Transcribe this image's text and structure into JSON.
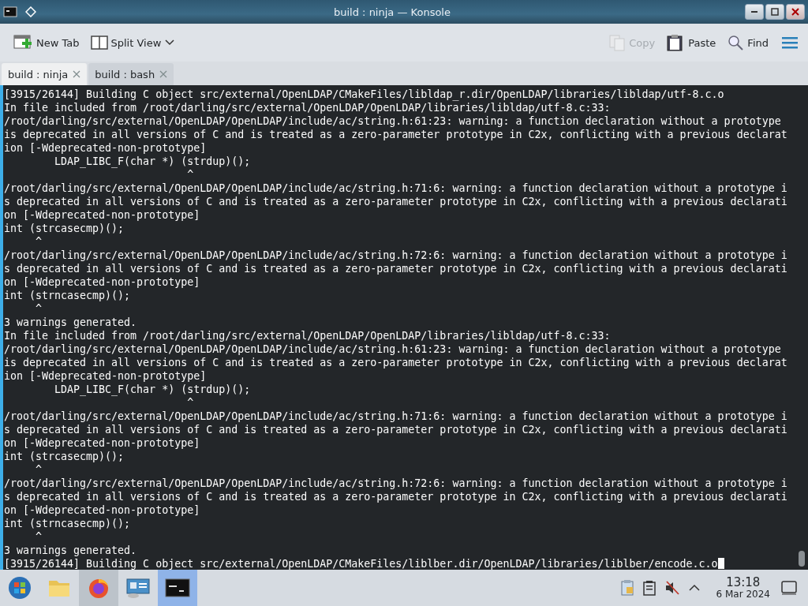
{
  "window": {
    "title": "build : ninja — Konsole"
  },
  "toolbar": {
    "left": [
      {
        "kind": "new-tab",
        "label": "New Tab",
        "disabled": false
      },
      {
        "kind": "split-view",
        "label": "Split View",
        "disabled": false
      }
    ],
    "right": [
      {
        "kind": "copy",
        "label": "Copy",
        "disabled": true
      },
      {
        "kind": "paste",
        "label": "Paste",
        "disabled": false
      },
      {
        "kind": "find",
        "label": "Find",
        "disabled": false
      }
    ]
  },
  "tabs": [
    {
      "label": "build : ninja",
      "selected": true
    },
    {
      "label": "build : bash",
      "selected": false
    }
  ],
  "terminal": {
    "cursor_visible": true,
    "lines": [
      "[3915/26144] Building C object src/external/OpenLDAP/CMakeFiles/libldap_r.dir/OpenLDAP/libraries/libldap/utf-8.c.o",
      "In file included from /root/darling/src/external/OpenLDAP/OpenLDAP/libraries/libldap/utf-8.c:33:",
      "/root/darling/src/external/OpenLDAP/OpenLDAP/include/ac/string.h:61:23: warning: a function declaration without a prototype",
      "is deprecated in all versions of C and is treated as a zero-parameter prototype in C2x, conflicting with a previous declarat",
      "ion [-Wdeprecated-non-prototype]",
      "        LDAP_LIBC_F(char *) (strdup)();",
      "                             ^",
      "/root/darling/src/external/OpenLDAP/OpenLDAP/include/ac/string.h:71:6: warning: a function declaration without a prototype i",
      "s deprecated in all versions of C and is treated as a zero-parameter prototype in C2x, conflicting with a previous declarati",
      "on [-Wdeprecated-non-prototype]",
      "int (strcasecmp)();",
      "     ^",
      "/root/darling/src/external/OpenLDAP/OpenLDAP/include/ac/string.h:72:6: warning: a function declaration without a prototype i",
      "s deprecated in all versions of C and is treated as a zero-parameter prototype in C2x, conflicting with a previous declarati",
      "on [-Wdeprecated-non-prototype]",
      "int (strncasecmp)();",
      "     ^",
      "3 warnings generated.",
      "In file included from /root/darling/src/external/OpenLDAP/OpenLDAP/libraries/libldap/utf-8.c:33:",
      "/root/darling/src/external/OpenLDAP/OpenLDAP/include/ac/string.h:61:23: warning: a function declaration without a prototype",
      "is deprecated in all versions of C and is treated as a zero-parameter prototype in C2x, conflicting with a previous declarat",
      "ion [-Wdeprecated-non-prototype]",
      "        LDAP_LIBC_F(char *) (strdup)();",
      "                             ^",
      "/root/darling/src/external/OpenLDAP/OpenLDAP/include/ac/string.h:71:6: warning: a function declaration without a prototype i",
      "s deprecated in all versions of C and is treated as a zero-parameter prototype in C2x, conflicting with a previous declarati",
      "on [-Wdeprecated-non-prototype]",
      "int (strcasecmp)();",
      "     ^",
      "/root/darling/src/external/OpenLDAP/OpenLDAP/include/ac/string.h:72:6: warning: a function declaration without a prototype i",
      "s deprecated in all versions of C and is treated as a zero-parameter prototype in C2x, conflicting with a previous declarati",
      "on [-Wdeprecated-non-prototype]",
      "int (strncasecmp)();",
      "     ^",
      "3 warnings generated.",
      "[3915/26144] Building C object src/external/OpenLDAP/CMakeFiles/liblber.dir/OpenLDAP/libraries/liblber/encode.c.o"
    ]
  },
  "taskbar": {
    "apps": [
      {
        "kind": "start",
        "selected": false,
        "hovered": false
      },
      {
        "kind": "files",
        "selected": false,
        "hovered": false
      },
      {
        "kind": "browser",
        "selected": false,
        "hovered": true
      },
      {
        "kind": "remote",
        "selected": false,
        "hovered": false
      },
      {
        "kind": "terminal",
        "selected": true,
        "hovered": false
      }
    ],
    "tray": [
      {
        "kind": "clipboard"
      },
      {
        "kind": "notes"
      },
      {
        "kind": "muted"
      },
      {
        "kind": "expand"
      }
    ],
    "clock": {
      "time": "13:18",
      "date": "6 Mar 2024"
    }
  }
}
